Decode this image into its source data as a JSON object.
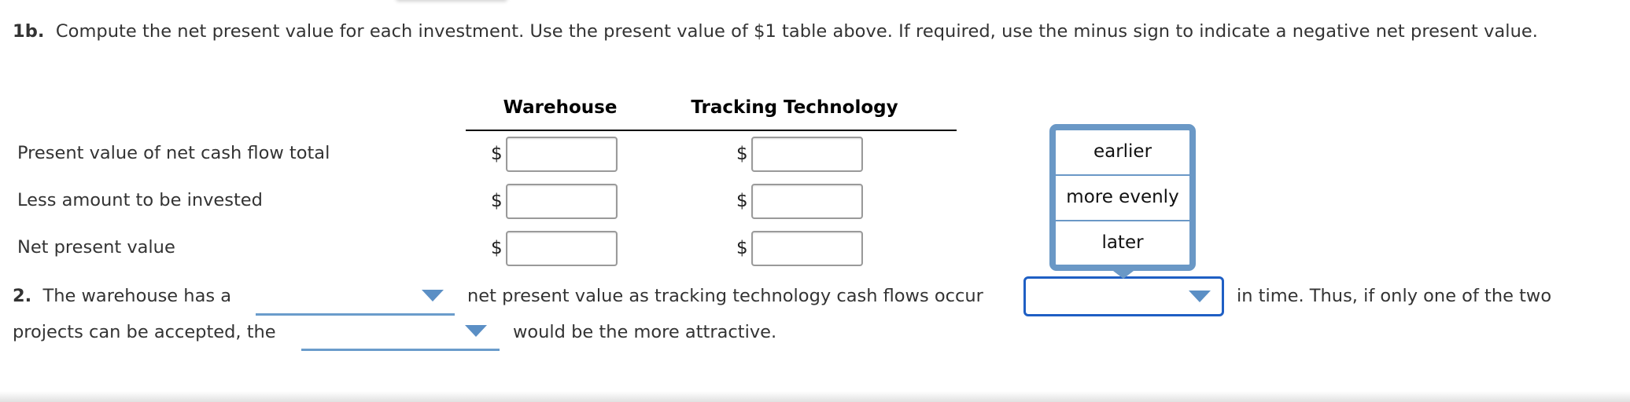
{
  "instructions": {
    "part_label": "1b.",
    "text": "Compute the net present value for each investment. Use the present value of $1 table above. If required, use the minus sign to indicate a negative net present value."
  },
  "table": {
    "columns": [
      "Warehouse",
      "Tracking Technology"
    ],
    "currency_symbol": "$",
    "rows": [
      {
        "label": "Present value of net cash flow total",
        "warehouse": "",
        "tracking": ""
      },
      {
        "label": "Less amount to be invested",
        "warehouse": "",
        "tracking": ""
      },
      {
        "label": "Net present value",
        "warehouse": "",
        "tracking": ""
      }
    ]
  },
  "question2": {
    "part_label": "2.",
    "text_1": "The warehouse has a",
    "dropdown_1_value": "",
    "text_2": "net present value as tracking technology cash flows occur",
    "dropdown_2_value": "",
    "text_3": "in time. Thus, if only one of the two",
    "text_4": "projects can be accepted, the",
    "dropdown_3_value": "",
    "text_5": "would be the more attractive."
  },
  "open_dropdown": {
    "options": [
      "earlier",
      "more evenly",
      "later"
    ]
  },
  "colors": {
    "dropdown_accent": "#6a98c6",
    "focus_border": "#1f5fc4",
    "text": "#333333"
  }
}
